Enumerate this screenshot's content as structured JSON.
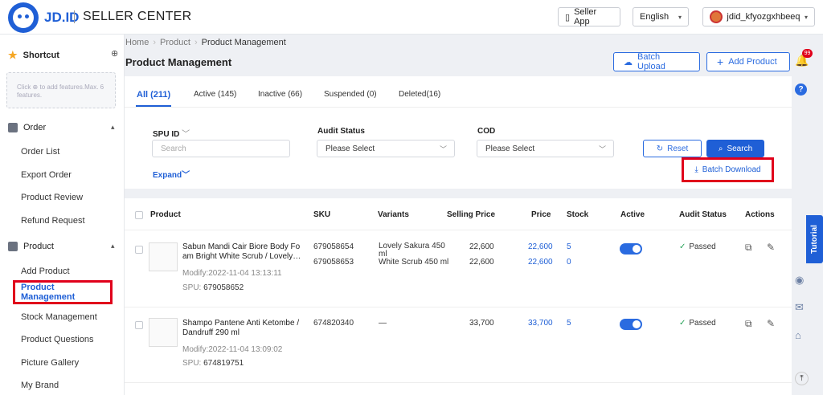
{
  "header": {
    "brand": "JD.ID",
    "subtitle": "SELLER CENTER",
    "seller_app": "Seller App",
    "language": "English",
    "username": "jdid_kfyozgxhbeeq"
  },
  "sidebar": {
    "shortcut_title": "Shortcut",
    "shortcut_hint": "Click ⊕ to add features.Max. 6 features.",
    "order_group": "Order",
    "order_items": [
      "Order List",
      "Export Order",
      "Product Review",
      "Refund Request"
    ],
    "product_group": "Product",
    "product_items": [
      "Add Product",
      "Product Management",
      "Stock Management",
      "Product Questions",
      "Picture Gallery",
      "My Brand"
    ]
  },
  "breadcrumb": {
    "home": "Home",
    "product": "Product",
    "current": "Product Management"
  },
  "page_title": "Product Management",
  "actions": {
    "batch_upload": "Batch Upload",
    "add_product": "Add Product"
  },
  "tabs": [
    "All (211)",
    "Active (145)",
    "Inactive (66)",
    "Suspended (0)",
    "Deleted(16)"
  ],
  "filters": {
    "spu_label": "SPU ID",
    "spu_placeholder": "Search",
    "audit_label": "Audit Status",
    "audit_value": "Please Select",
    "cod_label": "COD",
    "cod_value": "Please Select",
    "reset": "Reset",
    "search": "Search",
    "expand": "Expand",
    "batch_download": "Batch Download"
  },
  "table": {
    "headers": [
      "Product",
      "SKU",
      "Variants",
      "Selling Price",
      "Price",
      "Stock",
      "Active",
      "Audit Status",
      "Actions"
    ],
    "rows": [
      {
        "name": "Sabun Mandi Cair Biore Body Foam Bright White Scrub / Lovely...",
        "name_l1": "Sabun Mandi Cair Biore Body Fo",
        "name_l2": "am Bright White Scrub / Lovely…",
        "modify": "Modify:2022-11-04 13:13:11",
        "spu_label": "SPU:",
        "spu": "679058652",
        "skus": [
          "679058654",
          "679058653"
        ],
        "variants": [
          "Lovely Sakura 450 ml",
          "White Scrub 450 ml"
        ],
        "selling": [
          "22,600",
          "22,600"
        ],
        "price": [
          "22,600",
          "22,600"
        ],
        "stock": [
          "5",
          "0"
        ],
        "status": "Passed"
      },
      {
        "name_l1": "Shampo Pantene Anti Ketombe /",
        "name_l2": "Dandruff 290 ml",
        "modify": "Modify:2022-11-04 13:09:02",
        "spu_label": "SPU:",
        "spu": "674819751",
        "skus": [
          "674820340"
        ],
        "variants": [
          "—"
        ],
        "selling": [
          "33,700"
        ],
        "price": [
          "33,700"
        ],
        "stock": [
          "5"
        ],
        "status": "Passed"
      }
    ]
  },
  "right_panel": {
    "notification_count": "99",
    "tutorial": "Tutorial"
  },
  "colors": {
    "brand": "#1f5fd6",
    "highlight": "#e0001b",
    "passed": "#27a35a"
  }
}
